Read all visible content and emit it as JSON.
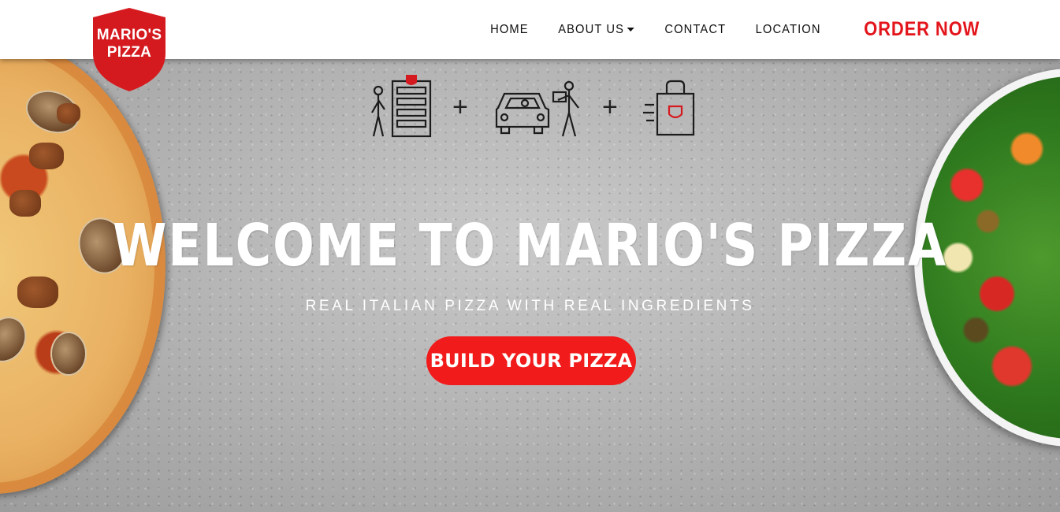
{
  "brand": {
    "logo_line1": "MARIO'S",
    "logo_line2": "PIZZA",
    "brand_color": "#e3141b"
  },
  "nav": {
    "items": [
      {
        "label": "HOME"
      },
      {
        "label": "ABOUT US",
        "has_dropdown": true
      },
      {
        "label": "CONTACT"
      },
      {
        "label": "LOCATION"
      }
    ],
    "order_label": "ORDER NOW"
  },
  "hero": {
    "headline": "WELCOME TO MARIO'S PIZZA",
    "subheadline": "REAL ITALIAN PIZZA WITH REAL INGREDIENTS",
    "cta_label": "BUILD YOUR PIZZA",
    "cta_color": "#f21b1b",
    "service_icons": [
      "pickup-oven-icon",
      "curbside-delivery-icon",
      "takeout-bag-icon"
    ],
    "separator": "+"
  }
}
